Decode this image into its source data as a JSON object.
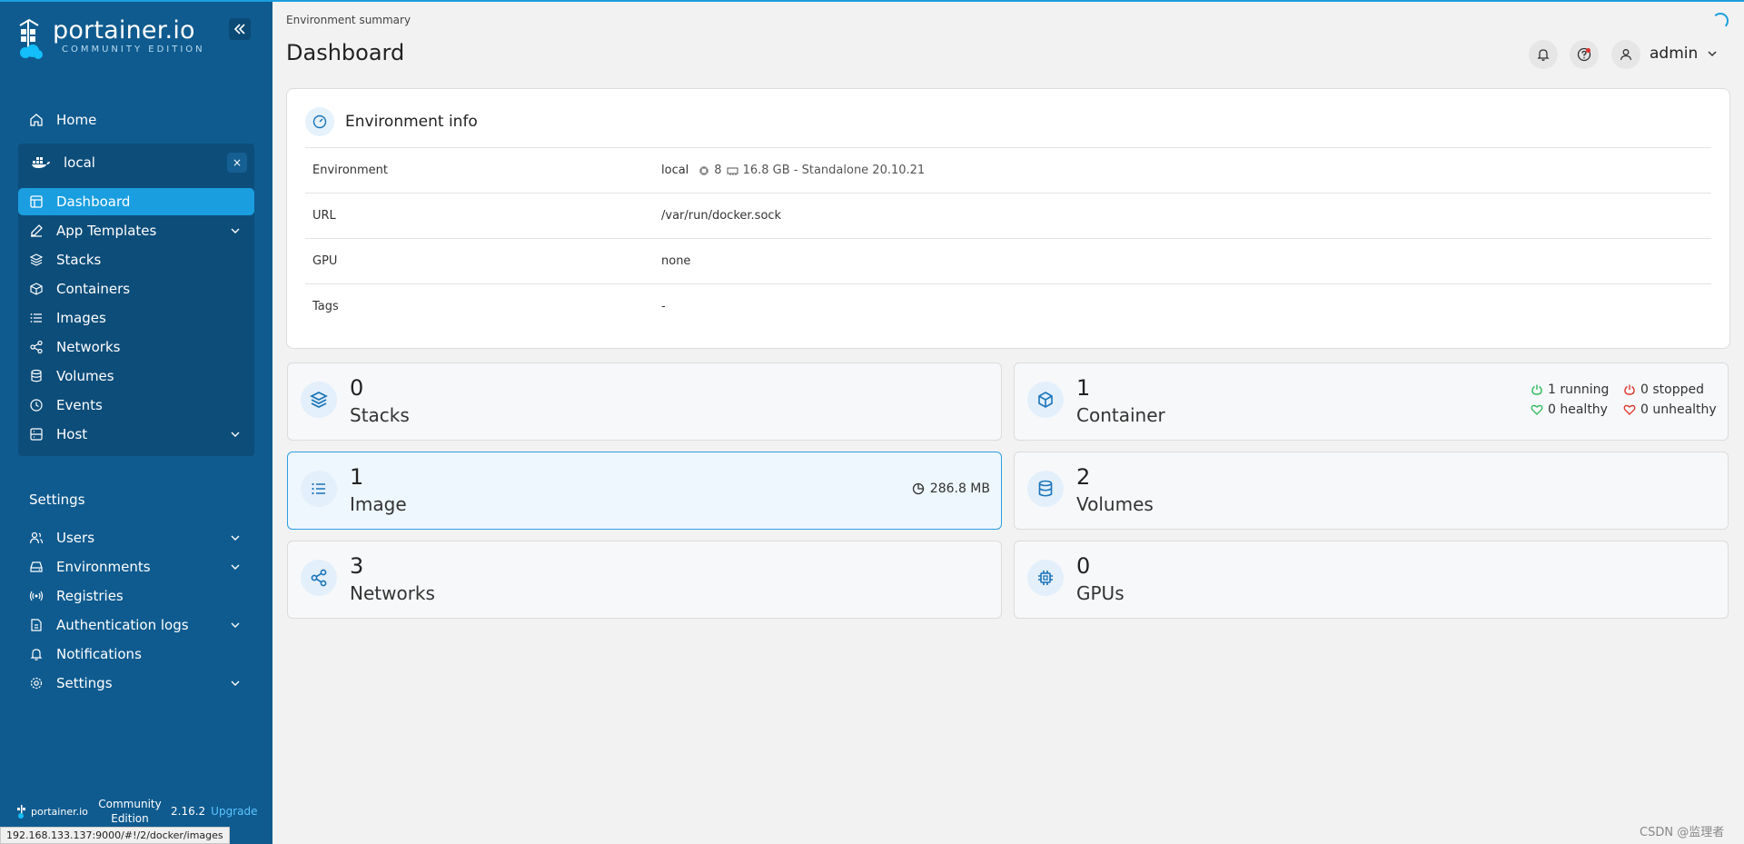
{
  "brand": {
    "name": "portainer.io",
    "edition_sub": "COMMUNITY EDITION",
    "accent": "#1a9ee0",
    "sidebar_bg": "#0f5b8f"
  },
  "sidebar": {
    "home_label": "Home",
    "environment": {
      "name": "local",
      "close_symbol": "×"
    },
    "env_items": [
      {
        "label": "Dashboard",
        "icon": "layout-icon",
        "active": true
      },
      {
        "label": "App Templates",
        "icon": "edit-icon",
        "expandable": true
      },
      {
        "label": "Stacks",
        "icon": "layers-icon"
      },
      {
        "label": "Containers",
        "icon": "box-icon"
      },
      {
        "label": "Images",
        "icon": "list-icon"
      },
      {
        "label": "Networks",
        "icon": "share-icon"
      },
      {
        "label": "Volumes",
        "icon": "database-icon"
      },
      {
        "label": "Events",
        "icon": "clock-icon"
      },
      {
        "label": "Host",
        "icon": "server-icon",
        "expandable": true
      }
    ],
    "settings_title": "Settings",
    "settings_items": [
      {
        "label": "Users",
        "icon": "users-icon",
        "expandable": true
      },
      {
        "label": "Environments",
        "icon": "hdd-icon",
        "expandable": true
      },
      {
        "label": "Registries",
        "icon": "radio-icon"
      },
      {
        "label": "Authentication logs",
        "icon": "file-icon",
        "expandable": true
      },
      {
        "label": "Notifications",
        "icon": "bell-icon"
      },
      {
        "label": "Settings",
        "icon": "gear-icon",
        "expandable": true
      }
    ],
    "footer": {
      "logo_text": "portainer.io",
      "edition": "Community Edition",
      "version": "2.16.2",
      "upgrade": "Upgrade"
    }
  },
  "header": {
    "breadcrumb": "Environment summary",
    "title": "Dashboard",
    "user": "admin"
  },
  "env_info": {
    "title": "Environment info",
    "rows": [
      {
        "key": "Environment",
        "value": "local",
        "cpu": "8",
        "memory": "16.8 GB - Standalone 20.10.21"
      },
      {
        "key": "URL",
        "value": "/var/run/docker.sock"
      },
      {
        "key": "GPU",
        "value": "none"
      },
      {
        "key": "Tags",
        "value": "-"
      }
    ]
  },
  "stats": {
    "stacks": {
      "count": "0",
      "label": "Stacks"
    },
    "containers": {
      "count": "1",
      "label": "Container",
      "running": "1 running",
      "stopped": "0 stopped",
      "healthy": "0 healthy",
      "unhealthy": "0 unhealthy"
    },
    "images": {
      "count": "1",
      "label": "Image",
      "size": "286.8 MB"
    },
    "volumes": {
      "count": "2",
      "label": "Volumes"
    },
    "networks": {
      "count": "3",
      "label": "Networks"
    },
    "gpus": {
      "count": "0",
      "label": "GPUs"
    }
  },
  "status_bar": {
    "url": "192.168.133.137:9000/#!/2/docker/images"
  },
  "watermark": "CSDN @监理者"
}
